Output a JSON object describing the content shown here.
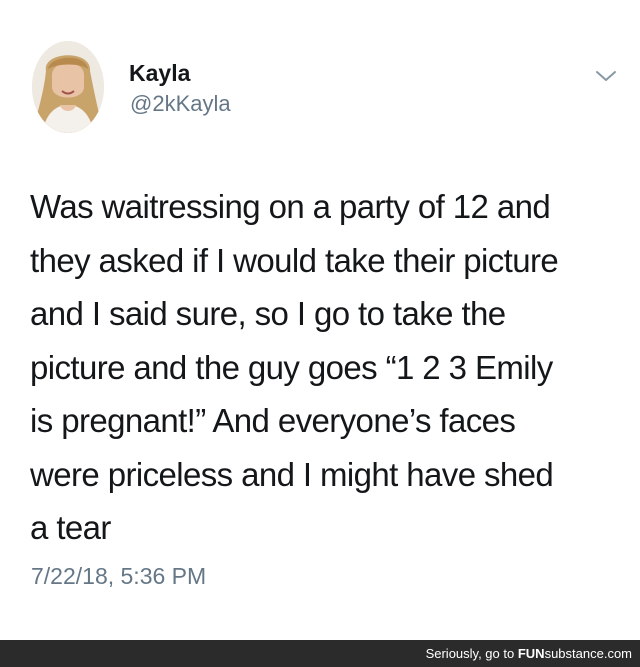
{
  "user": {
    "display_name": "Kayla",
    "handle": "@2kKayla",
    "avatar_icon": "profile-photo"
  },
  "tweet": {
    "lines": [
      "Was waitressing on a party of 12 and",
      "they asked if I would take their picture",
      "and I said sure, so I go to take the",
      "picture and the guy goes “1 2 3 Emily",
      "is pregnant!” And everyone’s faces",
      "were priceless and I might have shed",
      "a tear"
    ],
    "timestamp": "7/22/18, 5:36 PM"
  },
  "menu": {
    "icon": "chevron-down-icon"
  },
  "watermark": {
    "prefix": "Seriously, go to ",
    "brand_bold": "FUN",
    "brand_rest": "substance",
    "suffix": ".com"
  },
  "colors": {
    "text": "#14171a",
    "secondary": "#657786",
    "footer_bg": "#2b2b2b"
  }
}
